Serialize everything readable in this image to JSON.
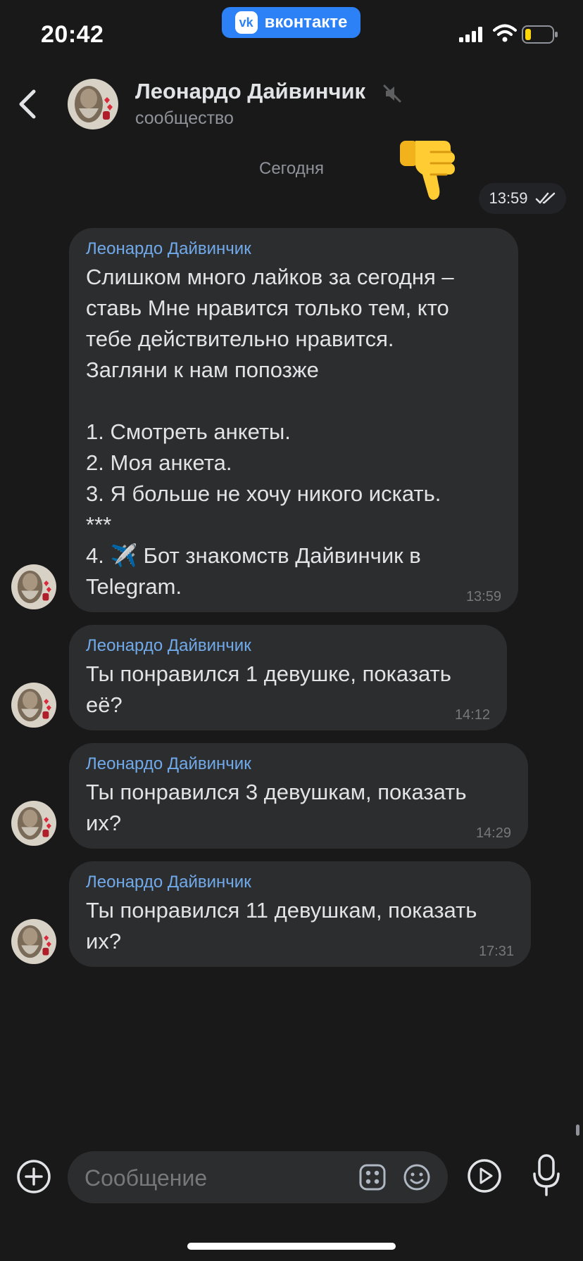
{
  "status_bar": {
    "time": "20:42",
    "app_badge": "вконтакте",
    "app_badge_logo": "vk"
  },
  "header": {
    "title": "Леонардо Дайвинчик",
    "subtitle": "сообщество",
    "muted": true
  },
  "chat": {
    "date_separator": "Сегодня",
    "outgoing": {
      "emoji": "thumbs-down",
      "time": "13:59",
      "status": "read"
    },
    "messages": [
      {
        "sender": "Леонардо Дайвинчик",
        "text": "Слишком много лайков за сегодня –\nставь Мне нравится только тем, кто\nтебе действительно нравится.\nЗагляни к нам попозже\n\n1. Смотреть анкеты.\n2. Моя анкета.\n3. Я больше не хочу никого искать.\n***\n4. ✈️ Бот знакомств Дайвинчик в\nTelegram.",
        "time": "13:59"
      },
      {
        "sender": "Леонардо Дайвинчик",
        "text": "Ты понравился 1 девушке, показать\neё?",
        "time": "14:12"
      },
      {
        "sender": "Леонардо Дайвинчик",
        "text": "Ты понравился 3 девушкам, показать\nих?",
        "time": "14:29"
      },
      {
        "sender": "Леонардо Дайвинчик",
        "text": "Ты понравился 11 девушкам, показать\nих?",
        "time": "17:31"
      }
    ]
  },
  "composer": {
    "placeholder": "Сообщение"
  },
  "colors": {
    "background": "#19191a",
    "bubble": "#2c2d2f",
    "accent": "#71aaeb",
    "vk_blue": "#2d81f7"
  }
}
